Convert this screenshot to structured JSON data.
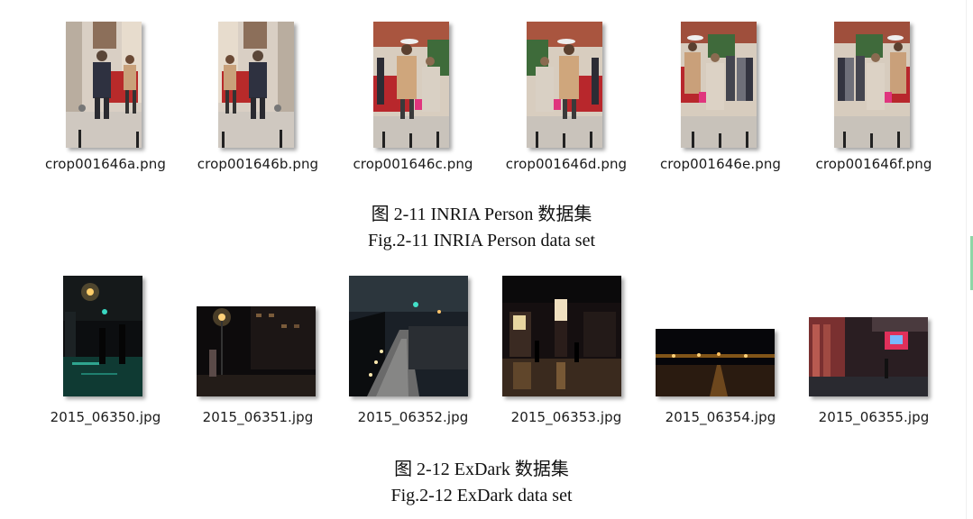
{
  "inria": {
    "files": [
      {
        "name": "crop001646a.png"
      },
      {
        "name": "crop001646b.png"
      },
      {
        "name": "crop001646c.png"
      },
      {
        "name": "crop001646d.png"
      },
      {
        "name": "crop001646e.png"
      },
      {
        "name": "crop001646f.png"
      }
    ],
    "caption_cn": "图 2-11 INRIA Person 数据集",
    "caption_en": "Fig.2-11 INRIA Person data set"
  },
  "exdark": {
    "files": [
      {
        "name": "2015_06350.jpg"
      },
      {
        "name": "2015_06351.jpg"
      },
      {
        "name": "2015_06352.jpg"
      },
      {
        "name": "2015_06353.jpg"
      },
      {
        "name": "2015_06354.jpg"
      },
      {
        "name": "2015_06355.jpg"
      }
    ],
    "caption_cn": "图 2-12 ExDark 数据集",
    "caption_en": "Fig.2-12 ExDark data set"
  },
  "colors": {
    "scroll_accent": "#8fd6a6"
  }
}
